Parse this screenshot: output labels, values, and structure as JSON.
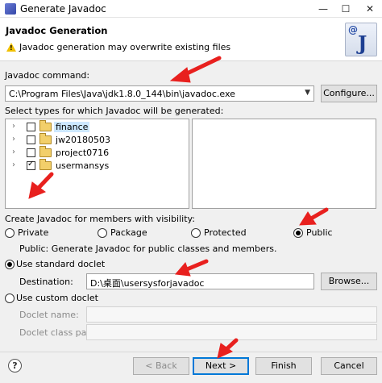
{
  "window": {
    "title": "Generate Javadoc",
    "minimize": "—",
    "maximize": "☐",
    "close": "✕"
  },
  "header": {
    "title": "Javadoc Generation",
    "message": "Javadoc generation may overwrite existing files",
    "logo_at": "@",
    "logo_j": "J"
  },
  "javadoc_command": {
    "label": "Javadoc command:",
    "value": "C:\\Program Files\\Java\\jdk1.8.0_144\\bin\\javadoc.exe",
    "configure_label": "Configure..."
  },
  "types": {
    "label": "Select types for which Javadoc will be generated:",
    "items": [
      {
        "name": "finance",
        "checked": false
      },
      {
        "name": "jw20180503",
        "checked": false
      },
      {
        "name": "project0716",
        "checked": false
      },
      {
        "name": "usermansys",
        "checked": true
      }
    ]
  },
  "visibility": {
    "label": "Create Javadoc for members with visibility:",
    "options": [
      "Private",
      "Package",
      "Protected",
      "Public"
    ],
    "selected": "Public",
    "description": "Public: Generate Javadoc for public classes and members."
  },
  "standard_doclet": {
    "label": "Use standard doclet",
    "destination_label": "Destination:",
    "destination_value": "D:\\桌面\\usersysforjavadoc",
    "browse_label": "Browse..."
  },
  "custom_doclet": {
    "label": "Use custom doclet",
    "name_label": "Doclet name:",
    "classpath_label": "Doclet class path:"
  },
  "footer": {
    "help": "?",
    "back_label": "< Back",
    "next_label": "Next >",
    "finish_label": "Finish",
    "cancel_label": "Cancel"
  },
  "colors": {
    "annotation_arrow": "#e8201e",
    "selection": "#cde8ff",
    "default_button_border": "#0078d7"
  }
}
